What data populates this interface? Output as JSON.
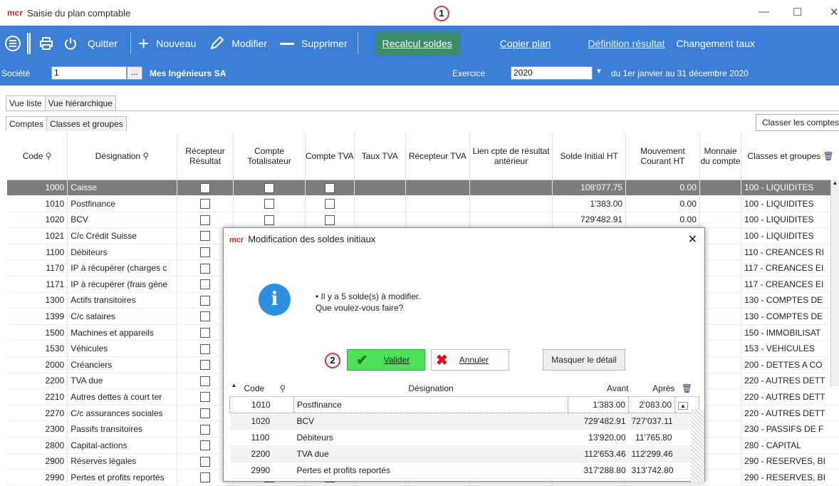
{
  "window": {
    "logo": "mcr",
    "title": "Saisie du plan comptable",
    "minimize": "—",
    "maximize": "☐",
    "close": "✕"
  },
  "toolbar": {
    "menu_icon": "menu-circle-icon",
    "print_icon": "printer-icon",
    "power_icon": "power-icon",
    "quit": "Quitter",
    "new": "Nouveau",
    "edit": "Modifier",
    "delete": "Supprimer",
    "recalc": "Recalcul soldes",
    "copy_plan": "Copier plan",
    "result_def": "Définition résultat",
    "rate_change": "Changement taux"
  },
  "filter": {
    "company_label": "Société",
    "company_value": "1",
    "company_btn": "...",
    "company_name": "Mes Ingénieurs SA",
    "year_label": "Exercice",
    "year_value": "2020",
    "period": "du 1er janvier au 31 décembre 2020"
  },
  "tabs": {
    "list": "Vue liste",
    "hier": "Vue hiérarchique",
    "accounts": "Comptes",
    "classes": "Classes et groupes",
    "sort_btn": "Classer les comptes"
  },
  "columns": [
    "Code",
    "Désignation",
    "Récepteur Résultat",
    "Compte Totalisateur",
    "Compte TVA",
    "Taux TVA",
    "Récepteur TVA",
    "Lien cpte de résultat antérieur",
    "Solde Initial HT",
    "Mouvement Courant HT",
    "Monnaie du compte",
    "Classes et groupes"
  ],
  "rows": [
    {
      "code": "1000",
      "name": "Caisse",
      "solde": "108'077.75",
      "mvt": "0.00",
      "group": "100 - LIQUIDITES"
    },
    {
      "code": "1010",
      "name": "Postfinance",
      "solde": "1'383.00",
      "mvt": "0.00",
      "group": "100 - LIQUIDITES"
    },
    {
      "code": "1020",
      "name": "BCV",
      "solde": "729'482.91",
      "mvt": "0.00",
      "group": "100 - LIQUIDITES"
    },
    {
      "code": "1021",
      "name": "C/c Crédit Suisse",
      "solde": "",
      "mvt": "",
      "group": "100 - LIQUIDITES"
    },
    {
      "code": "1100",
      "name": "Débiteurs",
      "solde": "",
      "mvt": "",
      "group": "110 - CREANCES RI"
    },
    {
      "code": "1170",
      "name": "IP à récupérer (charges c",
      "solde": "",
      "mvt": "",
      "group": "117 - CREANCES EI"
    },
    {
      "code": "1171",
      "name": "IP à récupérer (frais géne",
      "solde": "",
      "mvt": "",
      "group": "117 - CREANCES EI"
    },
    {
      "code": "1300",
      "name": "Actifs transitoires",
      "solde": "",
      "mvt": "",
      "group": "130 - COMPTES DE"
    },
    {
      "code": "1399",
      "name": "C/c salaires",
      "solde": "",
      "mvt": "",
      "group": "130 - COMPTES DE"
    },
    {
      "code": "1500",
      "name": "Machines et appareils",
      "solde": "",
      "mvt": "",
      "group": "150 - IMMOBILISAT"
    },
    {
      "code": "1530",
      "name": "Véhicules",
      "solde": "",
      "mvt": "",
      "group": "153 - VEHICULES"
    },
    {
      "code": "2000",
      "name": "Créanciers",
      "solde": "",
      "mvt": "",
      "group": "200 - DETTES A CO"
    },
    {
      "code": "2200",
      "name": "TVA due",
      "solde": "",
      "mvt": "",
      "group": "220 - AUTRES DETT"
    },
    {
      "code": "2210",
      "name": "Autres dettes à court ter",
      "solde": "",
      "mvt": "",
      "group": "220 - AUTRES DETT"
    },
    {
      "code": "2270",
      "name": "C/c assurances sociales",
      "solde": "",
      "mvt": "",
      "group": "220 - AUTRES DETT"
    },
    {
      "code": "2300",
      "name": "Passifs transitoires",
      "solde": "",
      "mvt": "",
      "group": "230 - PASSIFS DE F"
    },
    {
      "code": "2800",
      "name": "Capital-actions",
      "solde": "",
      "mvt": "",
      "group": "280 - CAPITAL"
    },
    {
      "code": "2900",
      "name": "Réserves légales",
      "solde": "",
      "mvt": "",
      "group": "290 - RESERVES, BI"
    },
    {
      "code": "2990",
      "name": "Pertes et profits reportés",
      "solde": "",
      "mvt": "",
      "group": "290 - RESERVES, BI"
    }
  ],
  "dialog": {
    "logo": "mcr",
    "title": "Modification des soldes initiaux",
    "close": "✕",
    "info_glyph": "i",
    "message1": "• Il y a 5 solde(s) à modifier.",
    "message2": "Que voulez-vous  faire?",
    "ok": "Valider",
    "cancel": "Annuler",
    "detail": "Masquer le détail",
    "columns": [
      "Code",
      "Désignation",
      "Avant",
      "Après"
    ],
    "rows": [
      {
        "code": "1010",
        "name": "Postfinance",
        "before": "1'383.00",
        "after": "2'083.00"
      },
      {
        "code": "1020",
        "name": "BCV",
        "before": "729'482.91",
        "after": "727'037.11"
      },
      {
        "code": "1100",
        "name": "Débiteurs",
        "before": "13'920.00",
        "after": "11'765.80"
      },
      {
        "code": "2200",
        "name": "TVA due",
        "before": "112'653.46",
        "after": "112'299.46"
      },
      {
        "code": "2990",
        "name": "Pertes et profits reportés",
        "before": "317'288.80",
        "after": "313'742.80"
      }
    ]
  },
  "callouts": {
    "one": "1",
    "two": "2"
  }
}
